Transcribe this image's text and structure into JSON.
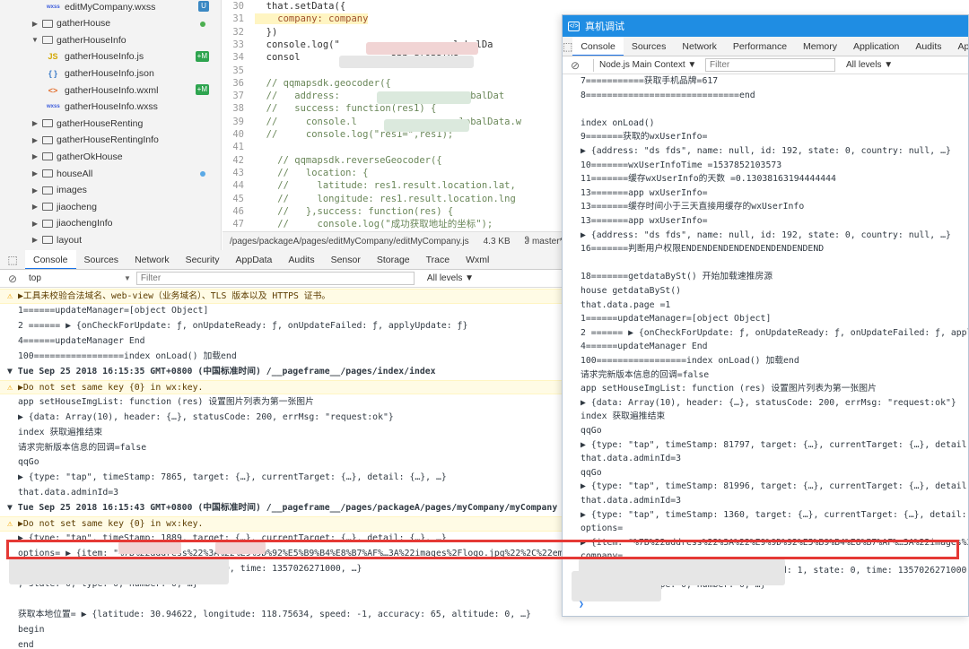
{
  "file_tree": {
    "items": [
      {
        "type": "file",
        "ico": "wxss",
        "name": "editMyCompany.wxss",
        "badge": "U",
        "indent": 2
      },
      {
        "type": "folder",
        "name": "gatherHouse",
        "marker": "green-dot",
        "indent": 1
      },
      {
        "type": "folder-open",
        "name": "gatherHouseInfo",
        "indent": 1
      },
      {
        "type": "file",
        "ico": "js",
        "name": "gatherHouseInfo.js",
        "badge": "M",
        "indent": 2
      },
      {
        "type": "file",
        "ico": "json",
        "name": "gatherHouseInfo.json",
        "indent": 2
      },
      {
        "type": "file",
        "ico": "wxml",
        "name": "gatherHouseInfo.wxml",
        "badge": "M",
        "indent": 2
      },
      {
        "type": "file",
        "ico": "wxss",
        "name": "gatherHouseInfo.wxss",
        "indent": 2
      },
      {
        "type": "folder",
        "name": "gatherHouseRenting",
        "indent": 1
      },
      {
        "type": "folder",
        "name": "gatherHouseRentingInfo",
        "indent": 1
      },
      {
        "type": "folder",
        "name": "gatherOkHouse",
        "indent": 1
      },
      {
        "type": "folder",
        "name": "houseAll",
        "marker": "blue-dot",
        "indent": 1
      },
      {
        "type": "folder",
        "name": "images",
        "indent": 1
      },
      {
        "type": "folder",
        "name": "jiaocheng",
        "indent": 1
      },
      {
        "type": "folder",
        "name": "jiaochengInfo",
        "indent": 1
      },
      {
        "type": "folder",
        "name": "layout",
        "indent": 1
      }
    ],
    "icon_text": {
      "js": "JS",
      "json": "{ }",
      "wxml": "<>",
      "wxss": "wxss"
    }
  },
  "editor": {
    "lines": [
      {
        "n": "30",
        "text": "  that.setData({",
        "kind": "code"
      },
      {
        "n": "31",
        "text": "    company: company",
        "kind": "hl"
      },
      {
        "n": "32",
        "text": "  })",
        "kind": "code"
      },
      {
        "n": "33",
        "text": "  console.log(\"              ,app.globalDa",
        "kind": "code"
      },
      {
        "n": "34",
        "text": "  consol               ,app.globalDa",
        "kind": "code"
      },
      {
        "n": "35",
        "text": "",
        "kind": "code"
      },
      {
        "n": "36",
        "text": "  // qqmapsdk.geocoder({",
        "kind": "comment"
      },
      {
        "n": "37",
        "text": "  //   address:              + app.globalDat",
        "kind": "comment"
      },
      {
        "n": "38",
        "text": "  //   success: function(res1) {",
        "kind": "comment"
      },
      {
        "n": "39",
        "text": "  //     console.l           + app.globalData.w",
        "kind": "comment"
      },
      {
        "n": "40",
        "text": "  //     console.log(\"res1=\",res1);",
        "kind": "comment"
      },
      {
        "n": "41",
        "text": "",
        "kind": "code"
      },
      {
        "n": "42",
        "text": "    // qqmapsdk.reverseGeocoder({",
        "kind": "comment"
      },
      {
        "n": "43",
        "text": "    //   location: {",
        "kind": "comment"
      },
      {
        "n": "44",
        "text": "    //     latitude: res1.result.location.lat,",
        "kind": "comment"
      },
      {
        "n": "45",
        "text": "    //     longitude: res1.result.location.lng",
        "kind": "comment"
      },
      {
        "n": "46",
        "text": "    //   },success: function(res) {",
        "kind": "comment"
      },
      {
        "n": "47",
        "text": "    //     console.log(\"成功获取地址的坐标\");",
        "kind": "comment"
      }
    ],
    "status": {
      "path": "/pages/packageA/pages/editMyCompany/editMyCompany.js",
      "size": "4.3 KB",
      "branch": "ჵ master*"
    }
  },
  "left_console": {
    "tabs": [
      "Console",
      "Sources",
      "Network",
      "Security",
      "AppData",
      "Audits",
      "Sensor",
      "Storage",
      "Trace",
      "Wxml"
    ],
    "context": "top",
    "filter_placeholder": "Filter",
    "levels": "All levels ▼",
    "logs": [
      {
        "kind": "warn",
        "text": "▶工具未校验合法域名、web-view（业务域名）、TLS 版本以及 HTTPS 证书。"
      },
      {
        "kind": "log",
        "text": "1======updateManager=[object Object]"
      },
      {
        "kind": "log",
        "text": "2 ====== ▶ {onCheckForUpdate: ƒ, onUpdateReady: ƒ, onUpdateFailed: ƒ, applyUpdate: ƒ}"
      },
      {
        "kind": "log",
        "text": "4======updateManager End"
      },
      {
        "kind": "log",
        "text": "100=================index onLoad() 加载end"
      },
      {
        "kind": "group",
        "text": "▼ Tue Sep 25 2018 16:15:35 GMT+0800 (中国标准时间) /__pageframe__/pages/index/index"
      },
      {
        "kind": "warn",
        "text": "▶Do not set same key {0} in wx:key."
      },
      {
        "kind": "log",
        "text": "app setHouseImgList: function (res) 设置图片列表为第一张图片"
      },
      {
        "kind": "log",
        "text": "▶ {data: Array(10), header: {…}, statusCode: 200, errMsg: \"request:ok\"}"
      },
      {
        "kind": "log",
        "text": "index 获取遍推结束"
      },
      {
        "kind": "log",
        "text": "请求完新版本信息的回调=false"
      },
      {
        "kind": "log",
        "text": "qqGo"
      },
      {
        "kind": "log",
        "text": "▶ {type: \"tap\", timeStamp: 7865, target: {…}, currentTarget: {…}, detail: {…}, …}"
      },
      {
        "kind": "log",
        "text": "that.data.adminId=3"
      },
      {
        "kind": "group",
        "text": "▼ Tue Sep 25 2018 16:15:43 GMT+0800 (中国标准时间) /__pageframe__/pages/packageA/pages/myCompany/myCompany"
      },
      {
        "kind": "warn",
        "text": "▶Do not set same key {0} in wx:key."
      },
      {
        "kind": "log",
        "text": "▶ {type: \"tap\", timeStamp: 1889, target: {…}, currentTarget: {…}, detail: {…}, …}"
      },
      {
        "kind": "log",
        "text": "options= ▶ {item: \"%7B%22address%22%3A%22%E9%9D%92%E5%B9%B4%E8%B7%AF%…3A%22images%2Flogo.jpg%22%2C%22email%22%3An"
      },
      {
        "kind": "log",
        "text": "company= ▶ {address:           , name:          1, state: 0, time: 1357026271000, …}"
      },
      {
        "kind": "log",
        "text": "                               , state: 0, type: 0, number: 0, …}"
      },
      {
        "kind": "log",
        "text": ""
      },
      {
        "kind": "log",
        "text": "获取本地位置= ▶ {latitude: 30.94622, longitude: 118.75634, speed: -1, accuracy: 65, altitude: 0, …}"
      },
      {
        "kind": "log",
        "text": "begin"
      },
      {
        "kind": "log",
        "text": "end"
      }
    ]
  },
  "right_window": {
    "title": "真机调试",
    "tabs": [
      "Console",
      "Sources",
      "Network",
      "Performance",
      "Memory",
      "Application",
      "Audits",
      "AppDat"
    ],
    "context": "Node.js Main Context ▼",
    "filter_placeholder": "Filter",
    "levels": "All levels ▼",
    "logs": [
      {
        "kind": "log",
        "text": "7===========获取手机品牌=617"
      },
      {
        "kind": "log",
        "text": "8=============================end"
      },
      {
        "kind": "log",
        "text": ""
      },
      {
        "kind": "log",
        "text": "index onLoad()"
      },
      {
        "kind": "log",
        "text": "9=======获取的wxUserInfo="
      },
      {
        "kind": "log",
        "text": "▶ {address: \"ds fds\", name: null, id: 192, state: 0, country: null, …}"
      },
      {
        "kind": "log",
        "text": "10=======wxUserInfoTime =1537852103573"
      },
      {
        "kind": "log",
        "text": "11=======缓存wxUserInfo的天数 =0.13038163194444444"
      },
      {
        "kind": "log",
        "text": "13=======app wxUserInfo="
      },
      {
        "kind": "log",
        "text": "13=======缓存时间小于三天直接用缓存的wxUserInfo"
      },
      {
        "kind": "log",
        "text": "13=======app wxUserInfo="
      },
      {
        "kind": "log",
        "text": "▶ {address: \"ds fds\", name: null, id: 192, state: 0, country: null, …}"
      },
      {
        "kind": "log",
        "text": "16=======判断用户权限ENDENDENDENDENDENDENDENDEND"
      },
      {
        "kind": "log",
        "text": ""
      },
      {
        "kind": "log",
        "text": "18=======getdataBySt() 开始加载速推房源"
      },
      {
        "kind": "log",
        "text": "house getdataBySt()"
      },
      {
        "kind": "log",
        "text": "that.data.page =1"
      },
      {
        "kind": "log",
        "text": "1======updateManager=[object Object]"
      },
      {
        "kind": "log",
        "text": "2 ====== ▶ {onCheckForUpdate: ƒ, onUpdateReady: ƒ, onUpdateFailed: ƒ, applyUpdate: ƒ}"
      },
      {
        "kind": "log",
        "text": "4======updateManager End"
      },
      {
        "kind": "log",
        "text": "100=================index onLoad() 加载end"
      },
      {
        "kind": "log",
        "text": "请求完新版本信息的回调=false"
      },
      {
        "kind": "log",
        "text": "app setHouseImgList: function (res) 设置图片列表为第一张图片"
      },
      {
        "kind": "log",
        "text": "▶ {data: Array(10), header: {…}, statusCode: 200, errMsg: \"request:ok\"}"
      },
      {
        "kind": "log",
        "text": "index 获取遍推结束"
      },
      {
        "kind": "log",
        "text": "qqGo"
      },
      {
        "kind": "log",
        "text": "▶ {type: \"tap\", timeStamp: 81797, target: {…}, currentTarget: {…}, detail: {…}, …}"
      },
      {
        "kind": "log",
        "text": "that.data.adminId=3"
      },
      {
        "kind": "log",
        "text": "qqGo"
      },
      {
        "kind": "log",
        "text": "▶ {type: \"tap\", timeStamp: 81996, target: {…}, currentTarget: {…}, detail: {…}, …}"
      },
      {
        "kind": "log",
        "text": "that.data.adminId=3"
      },
      {
        "kind": "log",
        "text": "▶ {type: \"tap\", timeStamp: 1360, target: {…}, currentTarget: {…}, detail: {…}, …}"
      },
      {
        "kind": "log",
        "text": "options="
      },
      {
        "kind": "log",
        "text": "▶ {item: \"%7B%22address%22%3A%22%E9%9D%92%E5%B9%B4%E8%B7%AF%…3A%22images%2Flogo.jp"
      },
      {
        "kind": "log",
        "text": "company="
      },
      {
        "kind": "log",
        "text": "▶ {address: \"青年路数 \", name: \"测试\", id: 1, state: 0, time: 1357026271000, …}"
      },
      {
        "kind": "log",
        "text": "                       3, state: 0, type: 0, number: 0, …}"
      }
    ],
    "prompt": "❯"
  },
  "colors": {
    "titlebar": "#1f8de3",
    "highlight": "#e53935",
    "warn_bg": "#fffbe5",
    "comment": "#6a8759"
  }
}
